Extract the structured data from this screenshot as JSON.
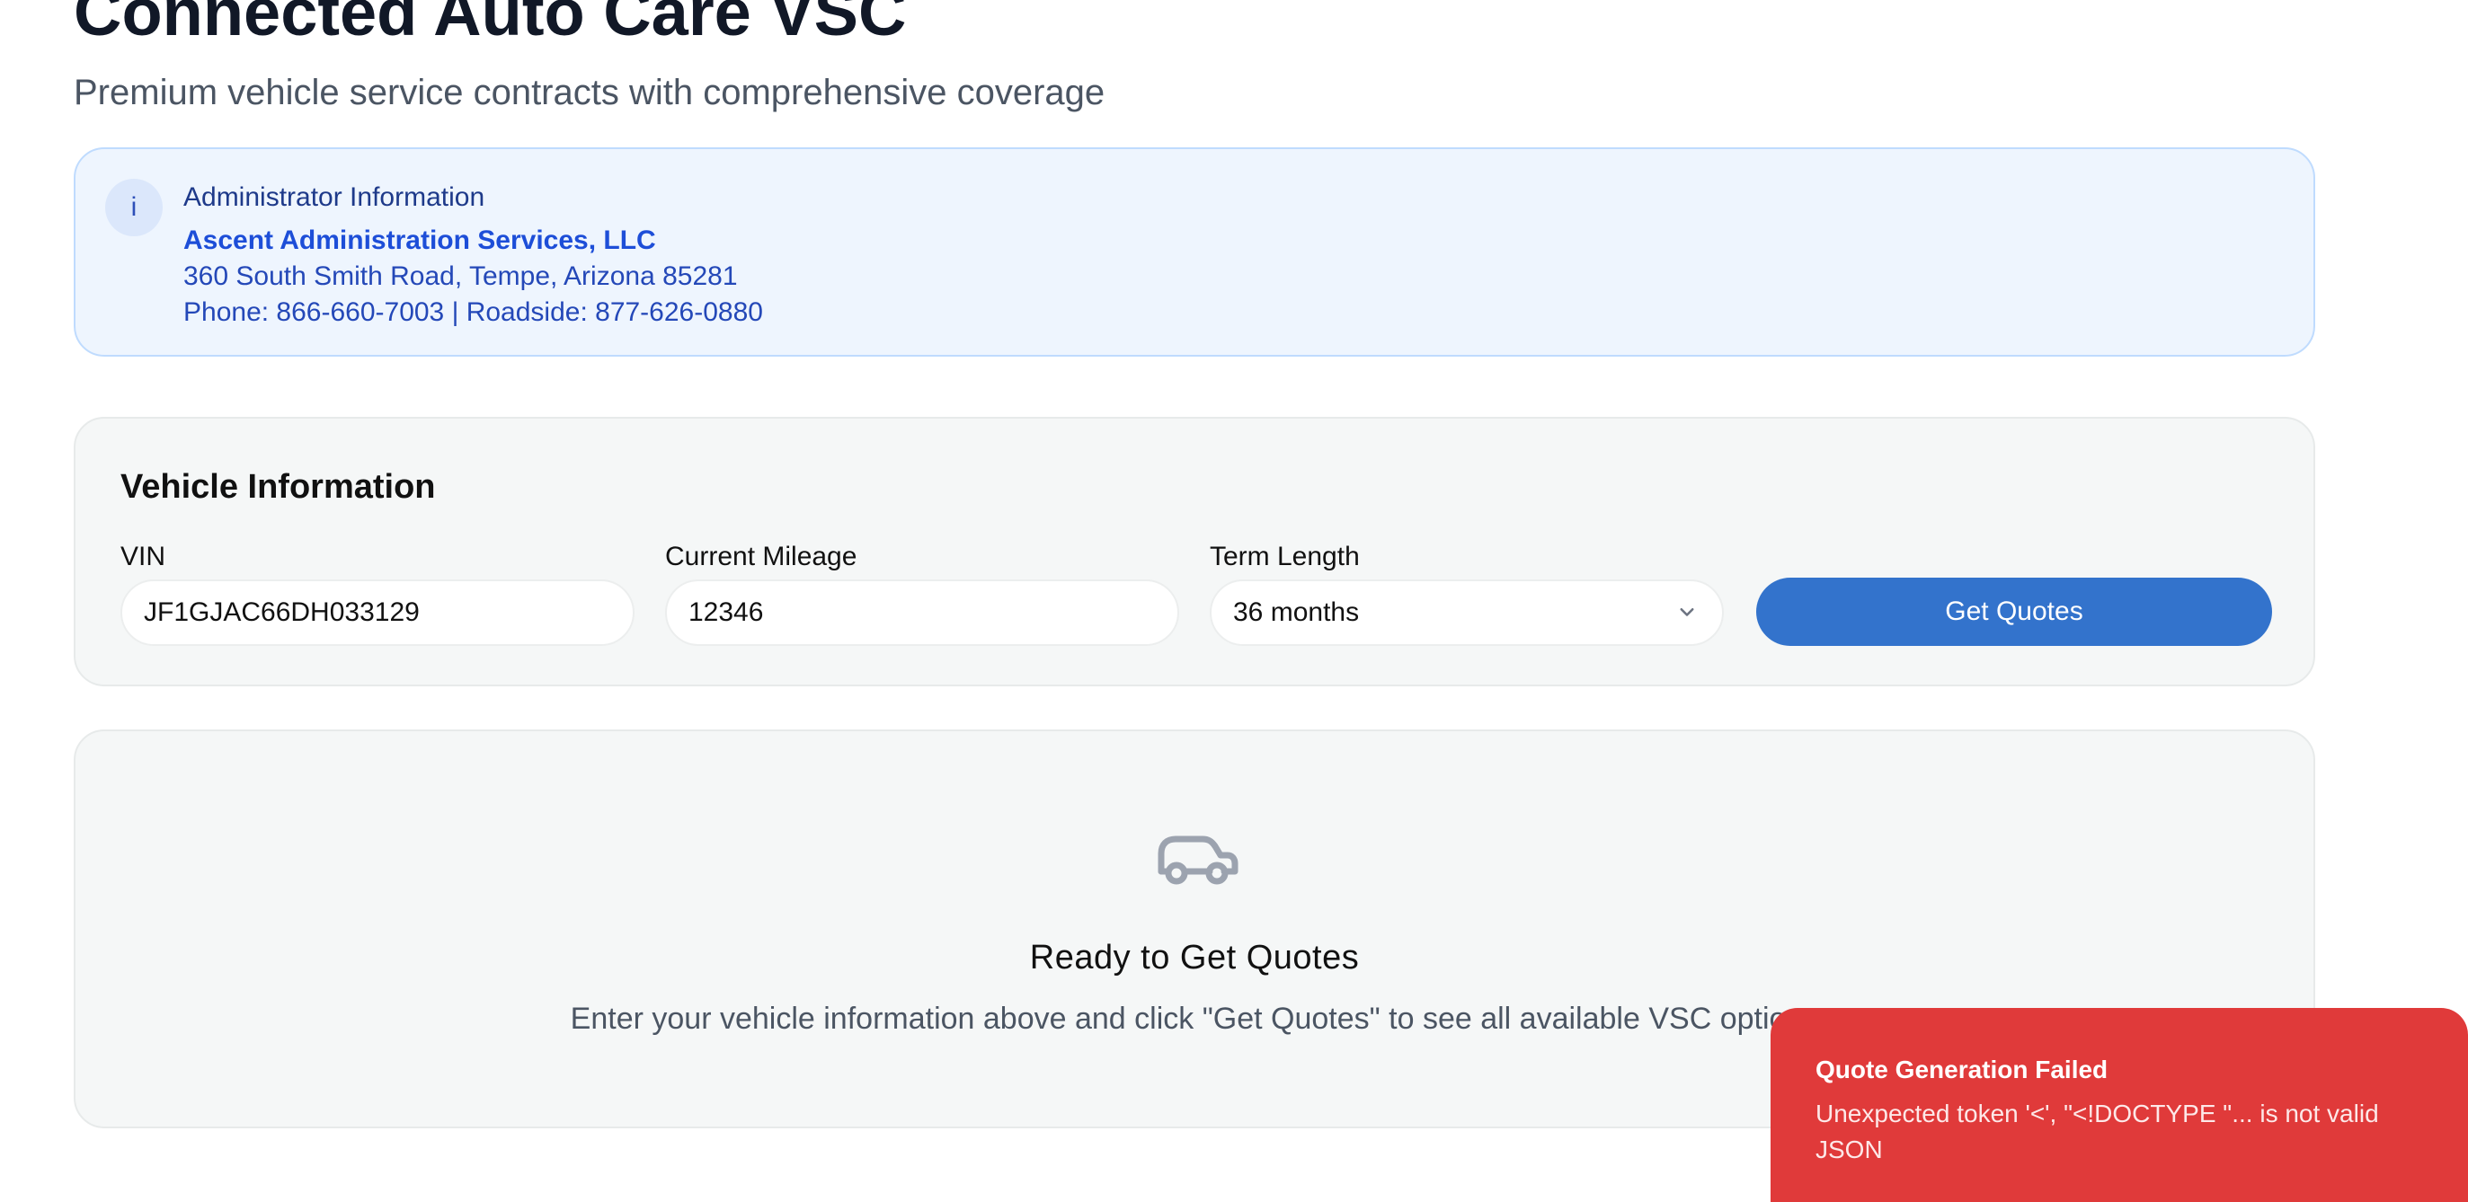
{
  "header": {
    "title": "Connected Auto Care VSC",
    "subtitle": "Premium vehicle service contracts with comprehensive coverage"
  },
  "admin": {
    "icon": "info-icon",
    "icon_glyph": "i",
    "label": "Administrator Information",
    "company": "Ascent Administration Services, LLC",
    "address": "360 South Smith Road, Tempe, Arizona 85281",
    "phones": "Phone: 866-660-7003 | Roadside: 877-626-0880"
  },
  "vehicle": {
    "heading": "Vehicle Information",
    "vin_label": "VIN",
    "vin_value": "JF1GJAC66DH033129",
    "mileage_label": "Current Mileage",
    "mileage_value": "12346",
    "term_label": "Term Length",
    "term_selected": "36 months",
    "submit_label": "Get Quotes"
  },
  "empty_state": {
    "icon": "car-icon",
    "title": "Ready to Get Quotes",
    "description": "Enter your vehicle information above and click \"Get Quotes\" to see all available VSC options"
  },
  "toast": {
    "title": "Quote Generation Failed",
    "message": "Unexpected token '<', \"<!DOCTYPE \"... is not valid JSON"
  },
  "colors": {
    "primary_button": "#3373cc",
    "admin_background": "#eef5fe",
    "admin_text": "#1d4ed8",
    "card_background": "#f5f7f7",
    "error_toast": "#e03a3a"
  }
}
